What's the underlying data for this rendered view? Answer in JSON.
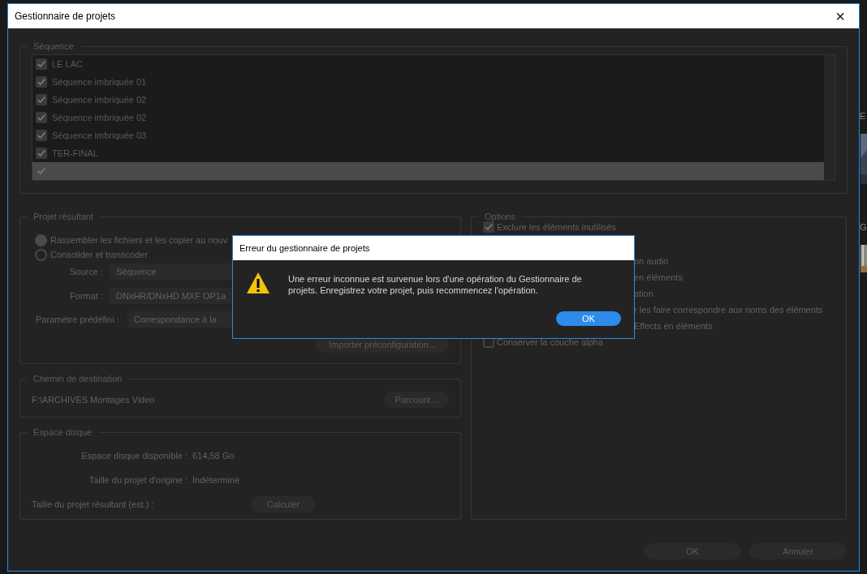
{
  "background": {
    "labels": [
      "E",
      "G"
    ]
  },
  "window": {
    "title": "Gestionnaire de projets",
    "close": "×"
  },
  "sequence": {
    "legend": "Séquence",
    "items": [
      {
        "label": "LE LAC",
        "checked": true,
        "selected": false
      },
      {
        "label": "Séquence imbriquée 01",
        "checked": true,
        "selected": false
      },
      {
        "label": "Séquence imbriquée 02",
        "checked": true,
        "selected": false
      },
      {
        "label": "Séquence imbriquée 02",
        "checked": true,
        "selected": false
      },
      {
        "label": "Séquence imbriquée 03",
        "checked": true,
        "selected": false
      },
      {
        "label": "TER-FINAL",
        "checked": true,
        "selected": false
      },
      {
        "checked": true,
        "selected": true
      }
    ]
  },
  "result": {
    "legend": "Projet résultant",
    "radios": [
      {
        "label": "Rassembler les fichiers et les copier au nouv",
        "selected": true
      },
      {
        "label": "Consolider et transcoder",
        "selected": false
      }
    ],
    "fields": [
      {
        "label": "Source :",
        "value": "Séquence"
      },
      {
        "label": "Format :",
        "value": "DNxHR/DNxHD MXF OP1a"
      }
    ],
    "preset": {
      "label": "Paramètre prédéfini :",
      "value": "Correspondance à la"
    },
    "import_button": "Importer préconfiguration..."
  },
  "destination": {
    "legend": "Chemin de destination",
    "path": "F:\\ARCHIVES Montages Video",
    "browse_button": "Parcourir..."
  },
  "disk": {
    "legend": "Espace disque",
    "rows": [
      {
        "label": "Espace disque disponible :",
        "value": "614,58 Go"
      },
      {
        "label": "Taille du projet d'origine :",
        "value": "Indéterminé"
      }
    ],
    "result_label": "Taille du projet résultant (est.) :",
    "calc_button": "Calculer"
  },
  "options": {
    "legend": "Options",
    "items": [
      {
        "kind": "full",
        "label": "Exclure les éléments inutilisés",
        "checked": true
      },
      {
        "kind": "fragment",
        "label": "on audio"
      },
      {
        "kind": "fragment",
        "label": "en éléments"
      },
      {
        "kind": "fragment",
        "label": "ation"
      },
      {
        "kind": "fragment",
        "label": "r les faire correspondre aux noms des éléments"
      },
      {
        "kind": "fragment",
        "label": "Effects en éléments"
      },
      {
        "kind": "full",
        "label": "Conserver la couche alpha",
        "checked": false
      }
    ]
  },
  "buttons": [
    "OK",
    "Annuler"
  ],
  "error_dialog": {
    "title": "Erreur du gestionnaire de projets",
    "message": "Une erreur inconnue est survenue lors d'une opération du Gestionnaire de projets. Enregistrez votre projet, puis recommencez l'opération.",
    "button": "OK"
  }
}
